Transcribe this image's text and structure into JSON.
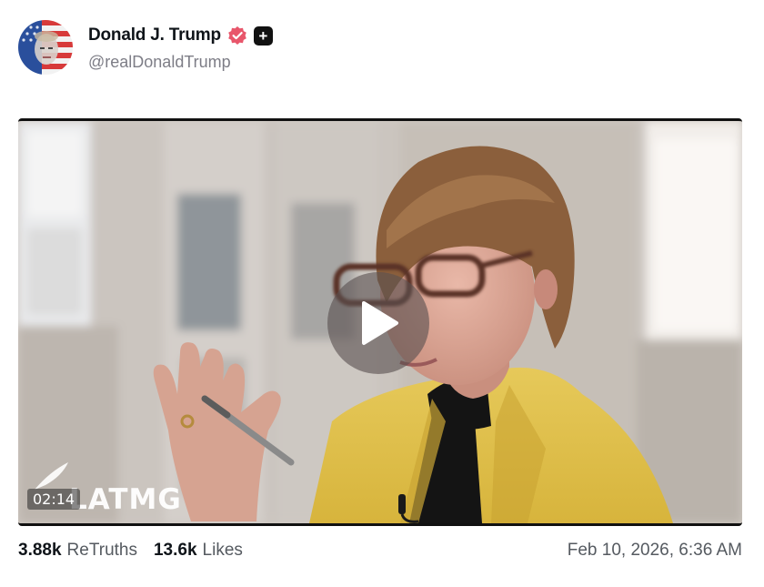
{
  "author": {
    "display_name": "Donald J. Trump",
    "handle": "@realDonaldTrump",
    "avatar_icon": "flag-portrait-avatar",
    "verified_icon": "verified-badge-icon",
    "verified_color": "#e8566b",
    "extra_badge_icon": "plus-badge-icon",
    "extra_badge_symbol": "+"
  },
  "media": {
    "type": "video",
    "duration": "02:14",
    "watermark": "LATMG",
    "play_icon": "play-icon"
  },
  "stats": {
    "retruths_count": "3.88k",
    "retruths_label": "ReTruths",
    "likes_count": "13.6k",
    "likes_label": "Likes"
  },
  "timestamp": "Feb 10, 2026, 6:36 AM"
}
